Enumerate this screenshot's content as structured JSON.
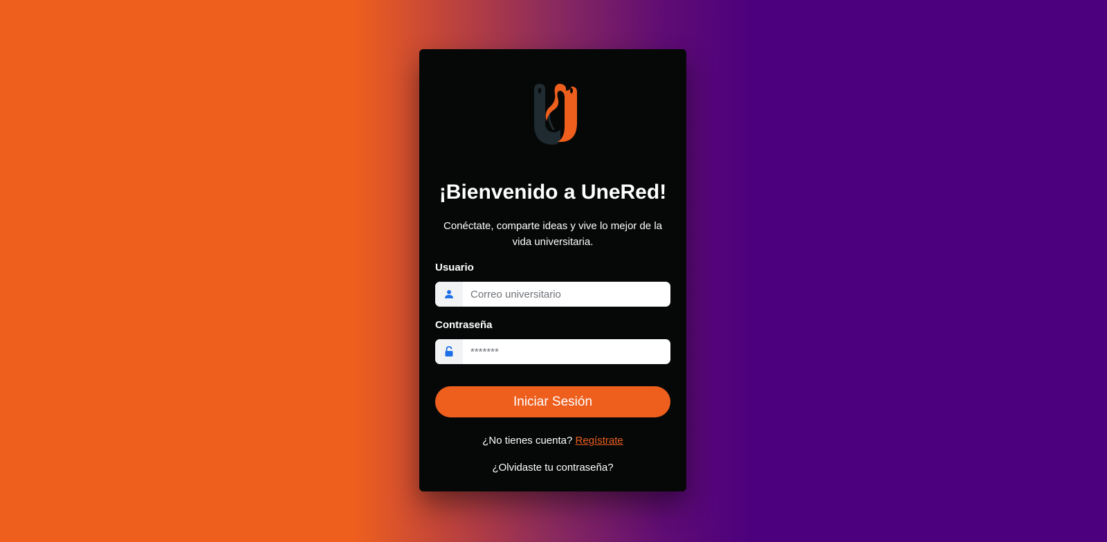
{
  "colors": {
    "accent": "#EE5F1E",
    "purple": "#4C007D",
    "card_bg": "#060808",
    "icon_blue": "#1E6FE8"
  },
  "logo": {
    "icon": "unered-logo-icon"
  },
  "header": {
    "title": "¡Bienvenido a UneRed!",
    "subtitle": "Conéctate, comparte ideas y vive lo mejor de la vida universitaria."
  },
  "form": {
    "username": {
      "label": "Usuario",
      "placeholder": "Correo universitario",
      "value": "",
      "icon": "user-icon"
    },
    "password": {
      "label": "Contraseña",
      "placeholder": "*******",
      "value": "",
      "icon": "lock-icon"
    },
    "submit_label": "Iniciar Sesión"
  },
  "footer": {
    "no_account_text": "¿No tienes cuenta?",
    "register_link": "Regístrate",
    "forgot_password": "¿Olvidaste tu contraseña?"
  }
}
